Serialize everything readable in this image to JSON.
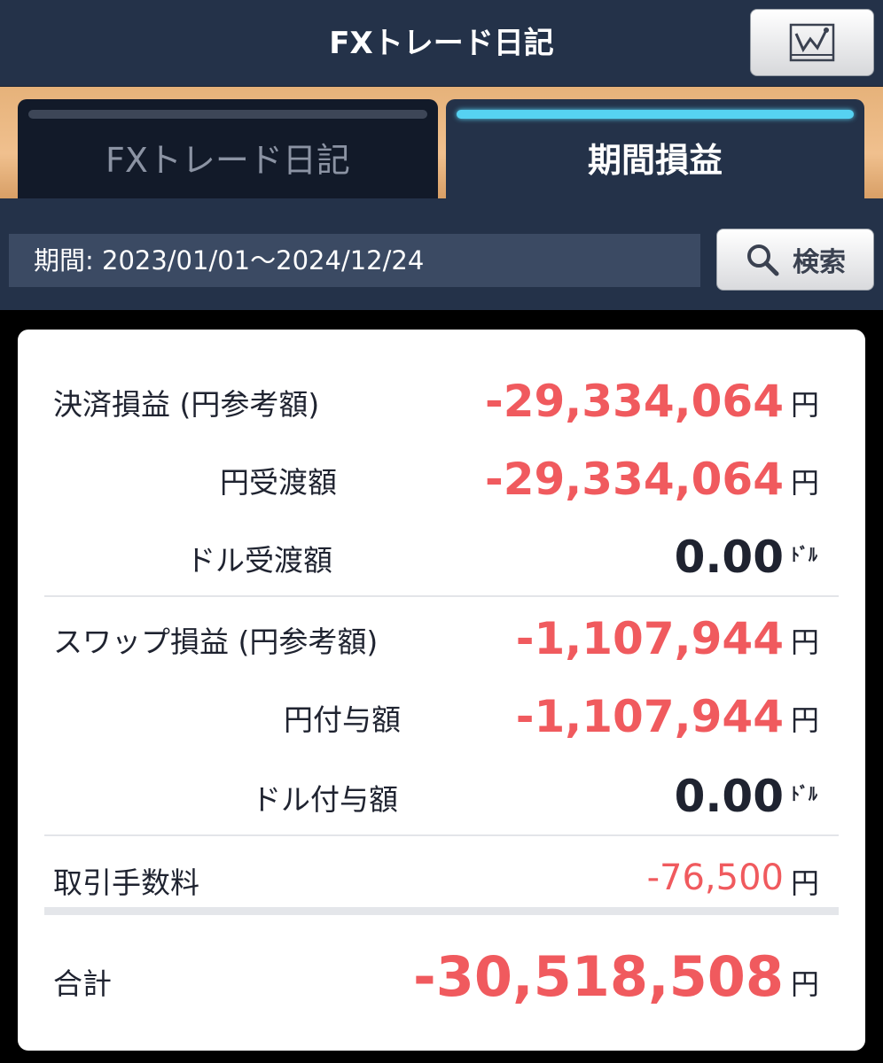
{
  "header": {
    "title": "FXトレード日記",
    "chart_icon": "chart-icon"
  },
  "tabs": [
    {
      "label": "FXトレード日記",
      "active": false
    },
    {
      "label": "期間損益",
      "active": true
    }
  ],
  "search": {
    "period_text": "期間: 2023/01/01～2024/12/24",
    "button_label": "検索",
    "icon": "search-icon"
  },
  "summary": {
    "settlement": {
      "label": "決済損益 (円参考額)",
      "value": "-29,334,064",
      "unit": "円"
    },
    "yen_transfer": {
      "label": "円受渡額",
      "value": "-29,334,064",
      "unit": "円"
    },
    "dollar_transfer": {
      "label": "ドル受渡額",
      "value": "0.00",
      "unit": "ﾄﾞﾙ"
    },
    "swap": {
      "label": "スワップ損益 (円参考額)",
      "value": "-1,107,944",
      "unit": "円"
    },
    "yen_granted": {
      "label": "円付与額",
      "value": "-1,107,944",
      "unit": "円"
    },
    "dollar_granted": {
      "label": "ドル付与額",
      "value": "0.00",
      "unit": "ﾄﾞﾙ"
    },
    "commission": {
      "label": "取引手数料",
      "value": "-76,500",
      "unit": "円"
    },
    "total": {
      "label": "合計",
      "value": "-30,518,508",
      "unit": "円"
    }
  },
  "colors": {
    "negative": "#f05a5e",
    "header_bg": "#243249",
    "accent": "#56d2f2"
  }
}
